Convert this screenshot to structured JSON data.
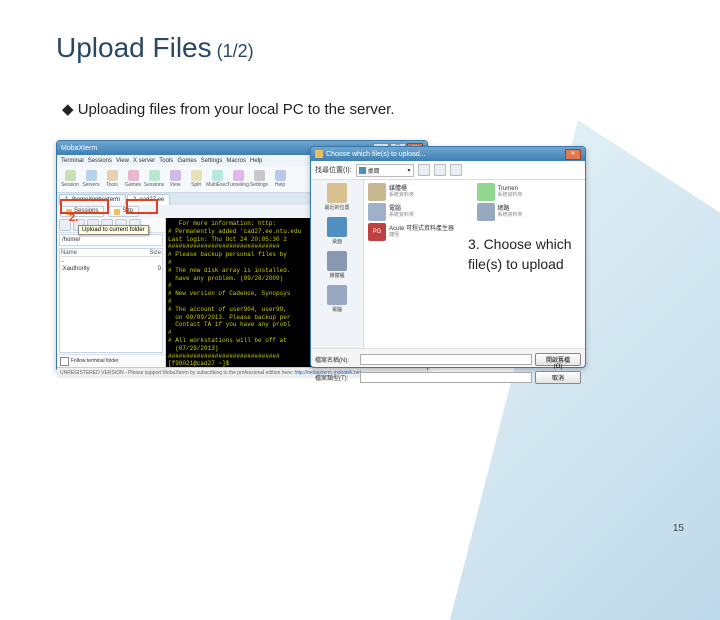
{
  "title_main": "Upload Files",
  "title_pg": " (1/2)",
  "bullet1": "Uploading files from your local PC to the server.",
  "moba": {
    "title": "MobaXterm",
    "menu": [
      "Terminal",
      "Sessions",
      "View",
      "X server",
      "Tools",
      "Games",
      "Settings",
      "Macros",
      "Help"
    ],
    "tools": [
      "Session",
      "Servers",
      "Tools",
      "Games",
      "Sessions",
      "View",
      "Split",
      "MultiExec",
      "Tunneling",
      "Settings",
      "Help"
    ],
    "tab1": "1. /home/mobaxterm",
    "tab2": "2. cad27.ee",
    "sub_sessions": "Sessions",
    "sub_sftp": "Sftp",
    "side": {
      "path": "/home/",
      "col_name": "Name",
      "col_size": "Size",
      "row_up": "..",
      "row_xauth": ".Xauthority",
      "follow": "Follow terminal folder"
    },
    "term": "   For more information: http:\n# Permanently added 'cad27.ee.ntu.edu\nLast login: Thu Oct 24 20:05:30 2\n###############################\n# Please backup personal files by\n#\n# The new disk array is installed.\n  have any problem. (09/28/2009)\n#\n# New version of Cadence, Synopsys\n#\n# The account of user904, user99,\n  on 09/09/2013. Please backup per\n  Contact TA if you have any probl\n#\n# All workstations will be off at\n  (07/29/2013)\n###############################\n[f99021@cad27 ~]$ ",
    "status_a": "UNREGISTERED VERSION - Please support MobaXterm by subscribing to the professional edition here: ",
    "status_b": "http://mobaxterm.mobatek.net"
  },
  "tooltip": "Upload to current folder",
  "dlg": {
    "title": "Choose which file(s) to upload...",
    "loc_label": "找尋位置(I):",
    "loc_value": "桌面",
    "places": [
      {
        "label": "最近的位置"
      },
      {
        "label": "桌面"
      },
      {
        "label": "媒體櫃"
      },
      {
        "label": "電腦"
      }
    ],
    "items": [
      {
        "main": "媒體櫃",
        "sub": "系統資料夾"
      },
      {
        "main": "Trumen",
        "sub": "系統資料夾"
      },
      {
        "main": "電腦",
        "sub": "系統資料夾"
      },
      {
        "main": "網路",
        "sub": "系統資料夾"
      },
      {
        "main": "Acute 可程式資料產生器",
        "sub": "捷徑"
      },
      {
        "main": "檔案名稱(N):",
        "sub": ""
      }
    ],
    "fname_label": "檔案名稱(N):",
    "ftype_label": "檔案類型(T):",
    "open_btn": "開啟舊檔(O)",
    "cancel_btn": "取消"
  },
  "anno": "3. Choose which file(s) to upload",
  "red_num1": "2.",
  "pgnum": "15"
}
